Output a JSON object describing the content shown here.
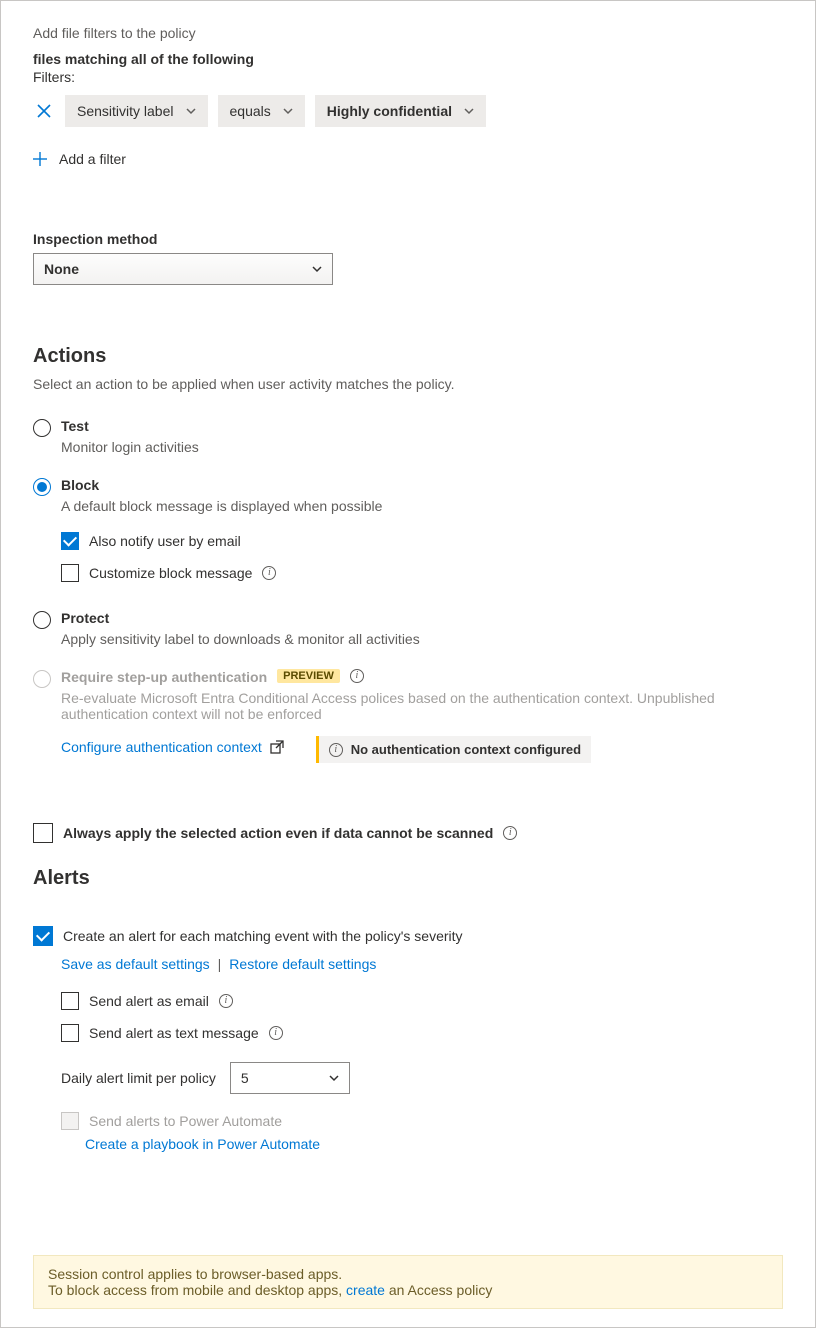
{
  "filters": {
    "hint": "Add file filters to the policy",
    "matching_label": "files matching all of the following",
    "filters_label": "Filters:",
    "field": "Sensitivity label",
    "operator": "equals",
    "value": "Highly confidential",
    "add_label": "Add a filter"
  },
  "inspection": {
    "label": "Inspection method",
    "value": "None"
  },
  "actions": {
    "title": "Actions",
    "desc": "Select an action to be applied when user activity matches the policy.",
    "test": {
      "label": "Test",
      "sub": "Monitor login activities"
    },
    "block": {
      "label": "Block",
      "sub": "A default block message is displayed when possible",
      "notify_label": "Also notify user by email",
      "customize_label": "Customize block message"
    },
    "protect": {
      "label": "Protect",
      "sub": "Apply sensitivity label to downloads & monitor all activities"
    },
    "stepup": {
      "label": "Require step-up authentication",
      "preview": "PREVIEW",
      "sub": "Re-evaluate Microsoft Entra Conditional Access polices based on the authentication context. Unpublished authentication context will not be enforced",
      "configure_link": "Configure authentication context",
      "warn": "No authentication context configured"
    },
    "always_apply": "Always apply the selected action even if data cannot be scanned"
  },
  "alerts": {
    "title": "Alerts",
    "create_label": "Create an alert for each matching event with the policy's severity",
    "save_default": "Save as default settings",
    "restore_default": "Restore default settings",
    "send_email": "Send alert as email",
    "send_text": "Send alert as text message",
    "daily_limit_label": "Daily alert limit per policy",
    "daily_limit_value": "5",
    "power_automate": "Send alerts to Power Automate",
    "playbook_link": "Create a playbook in Power Automate"
  },
  "footer": {
    "line1": "Session control applies to browser-based apps.",
    "line2a": "To block access from mobile and desktop apps, ",
    "line2_link": "create",
    "line2b": " an Access policy"
  }
}
